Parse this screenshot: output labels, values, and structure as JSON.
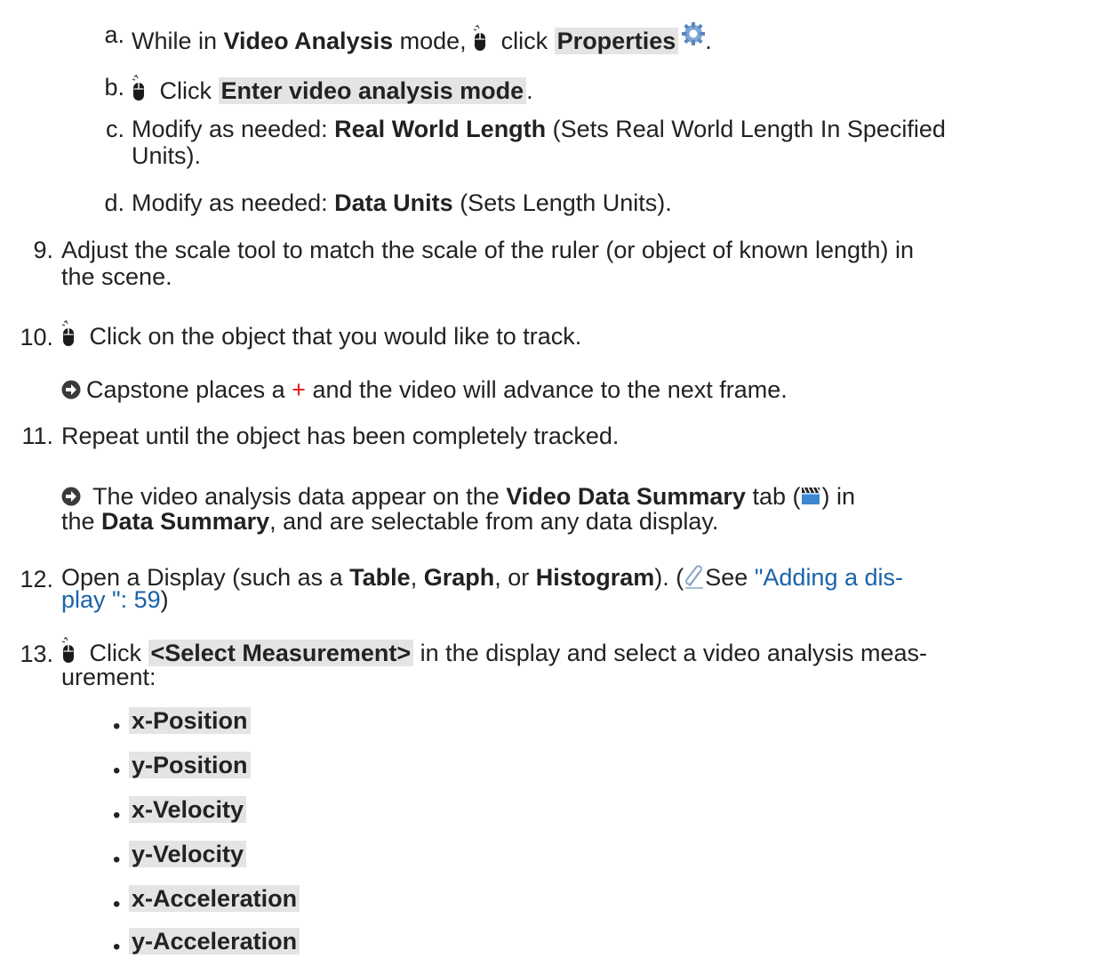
{
  "steps": {
    "a": {
      "num": "a.",
      "t1": "While in ",
      "b1": "Video Analysis",
      "t2": " mode, ",
      "t3": " click ",
      "hl1": "Properties",
      "end": "."
    },
    "b": {
      "num": "b.",
      "t1": " Click ",
      "hl1": "Enter video analysis mode",
      "end": "."
    },
    "c": {
      "num": "c.",
      "t1": "Modify as needed: ",
      "b1": "Real World Length",
      "t2": " (Sets Real World Length In Specified",
      "l2": "Units)."
    },
    "d": {
      "num": "d.",
      "t1": "Modify as needed: ",
      "b1": "Data Units",
      "t2": " (Sets Length Units)."
    },
    "s9": {
      "num": "9.",
      "l1": "Adjust the scale tool to match the scale of the ruler (or object of known length) in",
      "l2": "the scene."
    },
    "s10": {
      "num": "10.",
      "t1": " Click on the object that you would like to track.",
      "r1": "Capstone places a ",
      "plus": "+",
      "r2": " and the video will advance to the next frame."
    },
    "s11": {
      "num": "11.",
      "t1": "Repeat until the object has been completely tracked.",
      "r1": " The video analysis data appear on the ",
      "rb1": "Video Data Summary",
      "r2": " tab (",
      "r3": ") in",
      "l2a": "the ",
      "l2b": "Data Summary",
      "l2c": ", and are selectable from any data display."
    },
    "s12": {
      "num": "12.",
      "t1": "Open a Display (such as a ",
      "b1": "Table",
      "t2": ", ",
      "b2": "Graph",
      "t3": ", or ",
      "b3": "Histogram",
      "t4": "). (",
      "t5": "See ",
      "link1": "\"Adding a dis-",
      "link2": "play \":  59",
      "t6": ")"
    },
    "s13": {
      "num": "13.",
      "t1": " Click ",
      "hl1": "<Select Measurement>",
      "t2": " in the display and select a video analysis meas-",
      "l2": "urement:"
    }
  },
  "measurements": [
    "x-Position",
    "y-Position",
    "x-Velocity",
    "y-Velocity",
    "x-Acceleration",
    "y-Acceleration"
  ],
  "icons": {
    "mouse": "mouse-icon",
    "gear": "gear-icon",
    "arrow": "arrow-circle-icon",
    "clapper": "clapperboard-icon",
    "clip": "paperclip-icon"
  },
  "colors": {
    "link": "#1a62a8",
    "plus": "#e8141b",
    "highlight": "#e4e4e4"
  }
}
